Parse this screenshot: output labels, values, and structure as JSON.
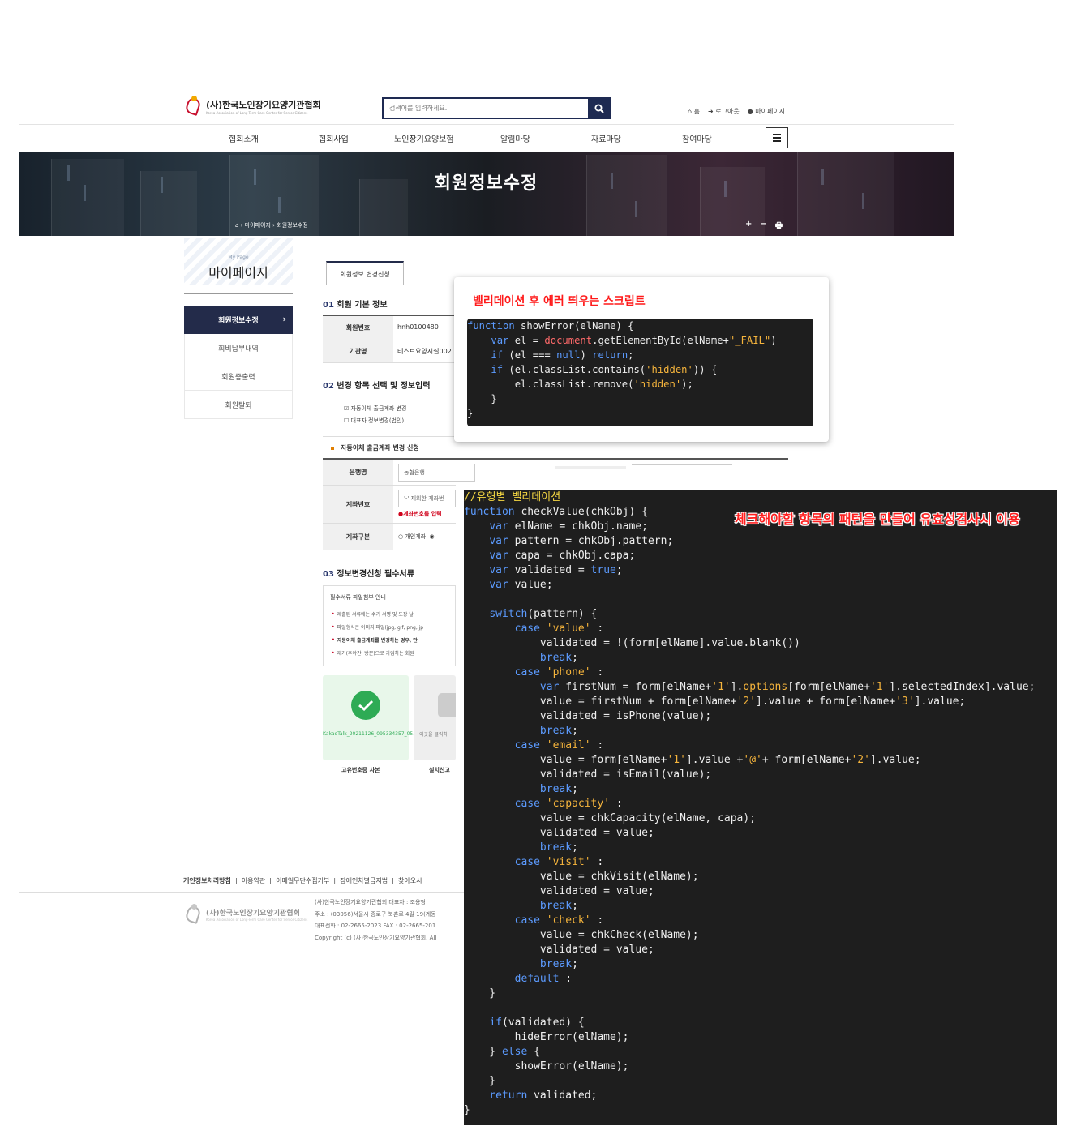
{
  "header": {
    "logo_main": "(사)한국노인장기요양기관협회",
    "logo_sub": "Korea Association of Long-Term Care Center for Senior Citizens",
    "search_placeholder": "검색어를 입력하세요.",
    "util_home": "홈",
    "util_logout": "로그아웃",
    "util_mypage": "마이페이지"
  },
  "nav": [
    "협회소개",
    "협회사업",
    "노인장기요양보험",
    "알림마당",
    "자료마당",
    "참여마당"
  ],
  "banner": {
    "title": "회원정보수정",
    "breadcrumb": [
      "마이페이지",
      "회원정보수정"
    ],
    "tools": [
      "+",
      "−",
      "🖶"
    ]
  },
  "sidebar": {
    "sub": "My Page",
    "title": "마이페이지",
    "items": [
      "회원정보수정",
      "회비납부내역",
      "회원증출력",
      "회원탈퇴"
    ]
  },
  "form": {
    "tab": "회원정보 변경신청",
    "sec1_num": "01",
    "sec1_title": "회원 기본 정보",
    "member_no_label": "회원번호",
    "member_no": "hnh0100480",
    "org_label": "기관명",
    "org_value": "테스트요양시설002",
    "sec2_num": "02",
    "sec2_title": "변경 항목 선택 및 정보입력",
    "check1": "자동이체 출금계좌 변경",
    "check2": "대표자 정보변경(법인)",
    "sub_heading": "자동이체 출금계좌 변경 신청",
    "bank_label": "은행명",
    "bank_value": "농협은행",
    "account_label": "계좌번호",
    "account_placeholder": "'-' 제외한 계좌번",
    "account_error": "계좌번호를 입력",
    "acct_type_label": "계좌구분",
    "acct_type_opt1": "개인계좌",
    "sec3_num": "03",
    "sec3_title": "정보변경신청 필수서류",
    "doc_heading": "필수서류 파일첨부 안내",
    "doc_lines": [
      "제출된 서류에는 수기 서명 및 도장 날",
      "파일형식은 이미지 파일(jpg, gif, png, jp",
      "자동이체 출금계좌를 변경하는 경우, 만",
      "재가(주야간, 방문)으로 가입하는 회원"
    ],
    "file_name": "KakaoTalk_20211126_095334357_05.jpg",
    "upload_hint": "이곳을 클릭하",
    "caption1": "고유번호증 사본",
    "caption2": "설치신고"
  },
  "footer": {
    "links": [
      "개인정보처리방침",
      "이용약관",
      "이메일무단수집거부",
      "장애인차별금지법",
      "찾아오시"
    ],
    "info": [
      "(사)한국노인장기요양기관협회   대표자 : 조용형",
      "주소 : (03056)서울시 종로구 북촌로 4길 19(계동",
      "대표전화 : 02-2665-2023   FAX : 02-2665-201",
      "Copyright (c) (사)한국노인장기요양기관협회. All"
    ]
  },
  "overlay": {
    "popup_title": "벨리데이션 후 에러 띄우는 스크립트",
    "code1": [
      "function showError(elName) {",
      "    var el = document.getElementById(elName+\"_FAIL\")",
      "    if (el === null) return;",
      "    if (el.classList.contains('hidden')) {",
      "        el.classList.remove('hidden');",
      "    }",
      "}"
    ],
    "note": "체크해야할 항목의 패턴을 만들어 유효성검사시 이용",
    "code2": [
      "//유형별 벨리데이션",
      "function checkValue(chkObj) {",
      "    var elName = chkObj.name;",
      "    var pattern = chkObj.pattern;",
      "    var capa = chkObj.capa;",
      "    var validated = true;",
      "    var value;",
      "",
      "    switch(pattern) {",
      "        case 'value' :",
      "            validated = !(form[elName].value.blank())",
      "            break;",
      "        case 'phone' :",
      "            var firstNum = form[elName+'1'].options[form[elName+'1'].selectedIndex].value;",
      "            value = firstNum + form[elName+'2'].value + form[elName+'3'].value;",
      "            validated = isPhone(value);",
      "            break;",
      "        case 'email' :",
      "            value = form[elName+'1'].value +'@'+ form[elName+'2'].value;",
      "            validated = isEmail(value);",
      "            break;",
      "        case 'capacity' :",
      "            value = chkCapacity(elName, capa);",
      "            validated = value;",
      "            break;",
      "        case 'visit' :",
      "            value = chkVisit(elName);",
      "            validated = value;",
      "            break;",
      "        case 'check' :",
      "            value = chkCheck(elName);",
      "            validated = value;",
      "            break;",
      "        default :",
      "    }",
      "",
      "    if(validated) {",
      "        hideError(elName);",
      "    } else {",
      "        showError(elName);",
      "    }",
      "    return validated;",
      "}"
    ]
  }
}
